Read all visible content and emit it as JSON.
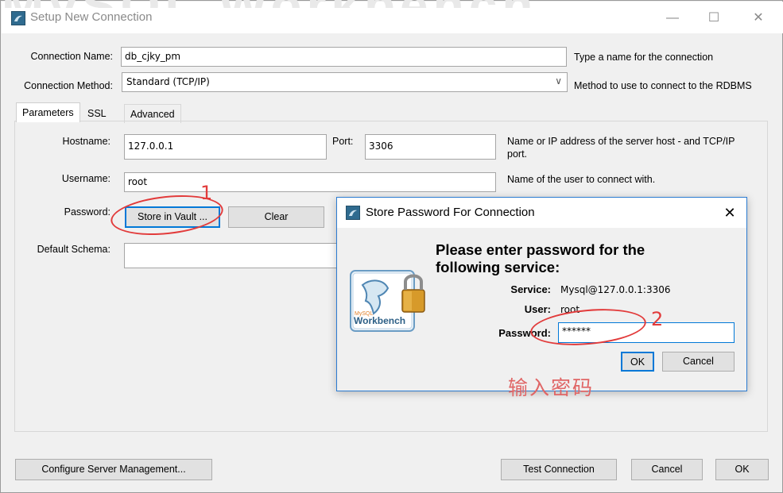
{
  "window": {
    "title": "Setup New Connection",
    "bg_title_text": "MySQL Workbench",
    "controls": {
      "minimize": "—",
      "maximize": "☐",
      "close": "✕"
    }
  },
  "form": {
    "connection_name": {
      "label": "Connection Name:",
      "value": "db_cjky_pm",
      "hint": "Type a name for the connection"
    },
    "connection_method": {
      "label": "Connection Method:",
      "value": "Standard (TCP/IP)",
      "hint": "Method to use to connect to the RDBMS"
    }
  },
  "tabs": [
    {
      "label": "Parameters",
      "active": true
    },
    {
      "label": "SSL",
      "active": false
    },
    {
      "label": "Advanced",
      "active": false
    }
  ],
  "parameters": {
    "hostname": {
      "label": "Hostname:",
      "value": "127.0.0.1",
      "hint": "Name or IP address of the server host - and TCP/IP port."
    },
    "port": {
      "label": "Port:",
      "value": "3306"
    },
    "username": {
      "label": "Username:",
      "value": "root",
      "hint": "Name of the user to connect with."
    },
    "password": {
      "label": "Password:",
      "store_button": "Store in Vault ...",
      "clear_button": "Clear"
    },
    "default_schema": {
      "label": "Default Schema:",
      "value": ""
    }
  },
  "footer": {
    "configure_button": "Configure Server Management...",
    "test_button": "Test Connection",
    "cancel_button": "Cancel",
    "ok_button": "OK"
  },
  "dialog": {
    "title": "Store Password For Connection",
    "close": "✕",
    "heading_line1": "Please enter password for the",
    "heading_line2": "following service:",
    "service_label": "Service:",
    "service_value": "Mysql@127.0.0.1:3306",
    "user_label": "User:",
    "user_value": "root",
    "password_label": "Password:",
    "password_value": "******",
    "ok_button": "OK",
    "cancel_button": "Cancel",
    "logo_text": "Workbench",
    "logo_small": "MySQL"
  },
  "annotations": {
    "num1": "1",
    "num2": "2",
    "note": "输入密码"
  },
  "colors": {
    "accent": "#0078d7",
    "annotation": "#e23b3b",
    "icon": "#2f6b8f"
  }
}
